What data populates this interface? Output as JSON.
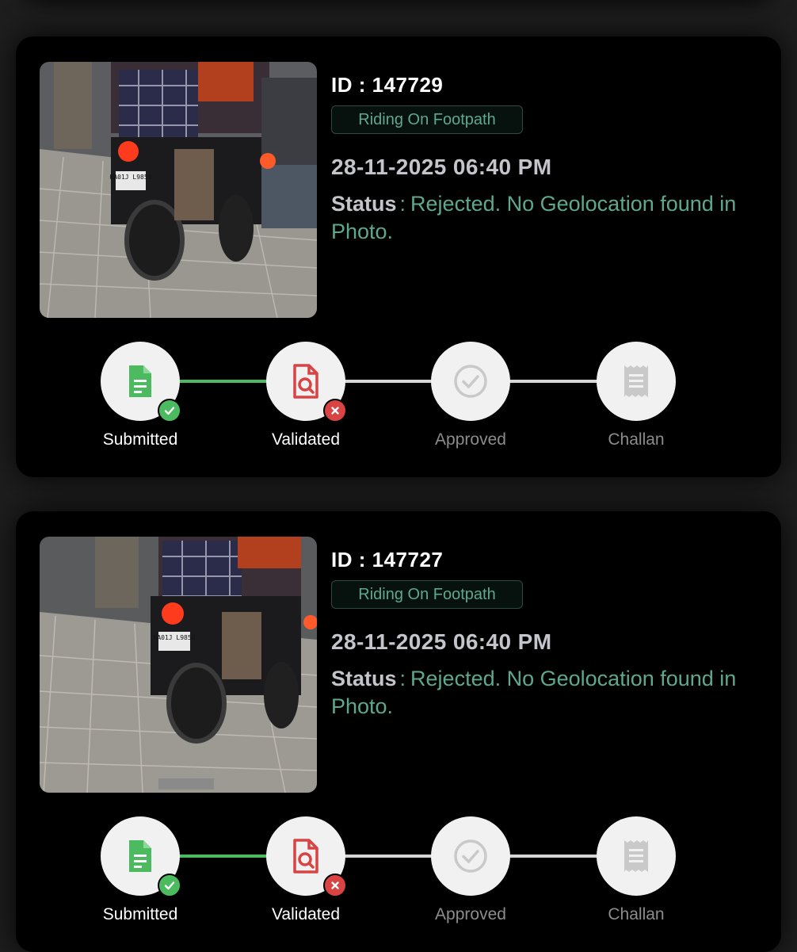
{
  "theme": {
    "accent_green": "#4cba5e",
    "reject_red": "#d94343",
    "status_teal": "#5ea88f",
    "inactive_gray": "#c9c9c9"
  },
  "reports": [
    {
      "id_text": "ID : 147729",
      "violation": "Riding On Footpath",
      "datetime": "28-11-2025 06:40 PM",
      "status_label": "Status",
      "status_separator": ":",
      "status_value": "Rejected. No Geolocation found in Photo.",
      "photo_icon": "motorcycle-on-footpath-photo",
      "plate_text": "KA01J L9850",
      "steps": [
        {
          "label": "Submitted",
          "icon": "document-icon",
          "state": "done"
        },
        {
          "label": "Validated",
          "icon": "document-search-icon",
          "state": "rejected"
        },
        {
          "label": "Approved",
          "icon": "check-circle-icon",
          "state": "pending"
        },
        {
          "label": "Challan",
          "icon": "receipt-icon",
          "state": "pending"
        }
      ]
    },
    {
      "id_text": "ID : 147727",
      "violation": "Riding On Footpath",
      "datetime": "28-11-2025 06:40 PM",
      "status_label": "Status",
      "status_separator": ":",
      "status_value": "Rejected. No Geolocation found in Photo.",
      "photo_icon": "motorcycle-on-footpath-photo",
      "plate_text": "KA01J L9850",
      "steps": [
        {
          "label": "Submitted",
          "icon": "document-icon",
          "state": "done"
        },
        {
          "label": "Validated",
          "icon": "document-search-icon",
          "state": "rejected"
        },
        {
          "label": "Approved",
          "icon": "check-circle-icon",
          "state": "pending"
        },
        {
          "label": "Challan",
          "icon": "receipt-icon",
          "state": "pending"
        }
      ]
    }
  ]
}
